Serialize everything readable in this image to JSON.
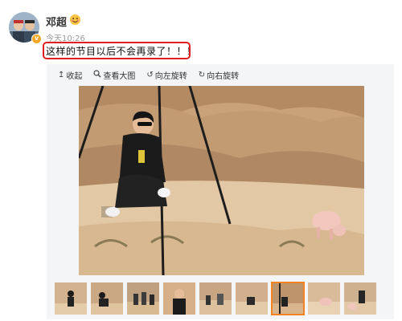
{
  "post": {
    "username": "邓超",
    "time": "今天10:26",
    "text": "这样的节目以后不会再录了！！！",
    "avatar_icon": "avatar-photo",
    "verified_icon": "verified-v-icon",
    "badge_icon": "smile-emoji-icon"
  },
  "toolbar": {
    "collapse_label": "收起",
    "view_large_label": "查看大图",
    "rotate_left_label": "向左旋转",
    "rotate_right_label": "向右旋转"
  },
  "gallery": {
    "thumbnail_count": 9,
    "active_index": 6
  },
  "colors": {
    "highlight_border": "#e02020",
    "active_thumb": "#f58220",
    "vip_badge": "#f4a624"
  }
}
